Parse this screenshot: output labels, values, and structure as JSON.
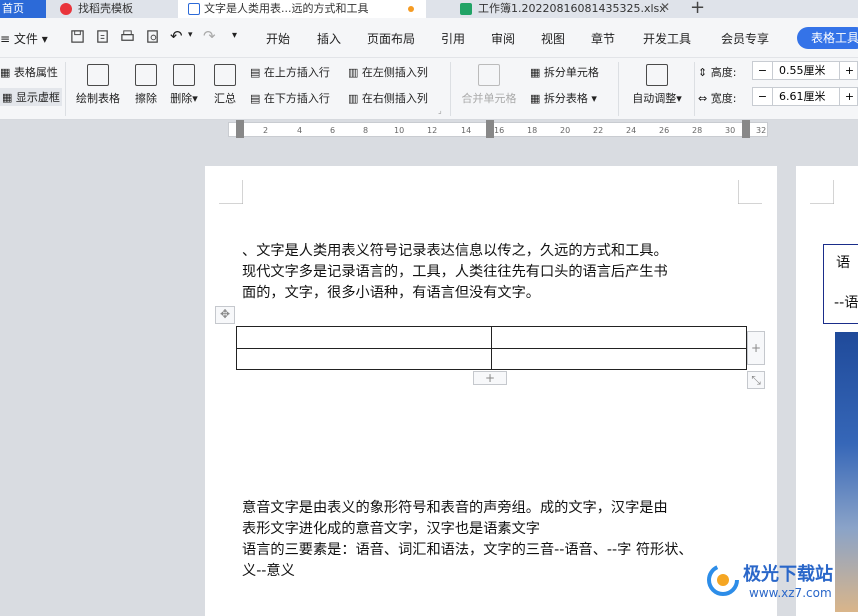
{
  "tabs": {
    "home": "首页",
    "template": "找稻壳模板",
    "doc": "文字是人类用表...远的方式和工具",
    "sheet": "工作簿1.20220816081435325.xlsx"
  },
  "menu": {
    "file": "文件",
    "items": [
      "开始",
      "插入",
      "页面布局",
      "引用",
      "审阅",
      "视图",
      "章节",
      "开发工具",
      "会员专享"
    ],
    "table_tools": "表格工具"
  },
  "ribbon": {
    "table_props": "表格属性",
    "show_grid": "显示虚框",
    "draw_table": "绘制表格",
    "erase": "擦除",
    "delete": "删除",
    "summary": "汇总",
    "insert_above": "在上方插入行",
    "insert_below": "在下方插入行",
    "insert_left": "在左侧插入列",
    "insert_right": "在右侧插入列",
    "merge_cells": "合并单元格",
    "split_cells": "拆分单元格",
    "split_table": "拆分表格",
    "auto_adjust": "自动调整",
    "height_label": "高度:",
    "height_value": "0.55厘米",
    "width_label": "宽度:",
    "width_value": "6.61厘米"
  },
  "ruler": {
    "ticks": [
      "2",
      "4",
      "6",
      "8",
      "10",
      "12",
      "14",
      "16",
      "18",
      "20",
      "22",
      "24",
      "26",
      "28",
      "30",
      "32"
    ]
  },
  "document": {
    "para1_line1": "、文字是人类用表义符号记录表达信息以传之，久远的方式和工具。",
    "para1_line2": "现代文字多是记录语言的，工具，人类往往先有口头的语言后产生书",
    "para1_line3": "面的，文字，很多小语种，有语言但没有文字。",
    "para2_line1": "意音文字是由表义的象形符号和表音的声旁组。成的文字，汉字是由",
    "para2_line2": "表形文字进化成的意音文字，汉字也是语素文字",
    "para3_line1": "语言的三要素是：语音、词汇和语法，文字的三音--语音、--字  符形状、",
    "para3_line2": "义--意义",
    "page2_line1": "语",
    "page2_line2": "--语"
  },
  "watermark": {
    "name": "极光下载站",
    "url": "www.xz7.com"
  }
}
